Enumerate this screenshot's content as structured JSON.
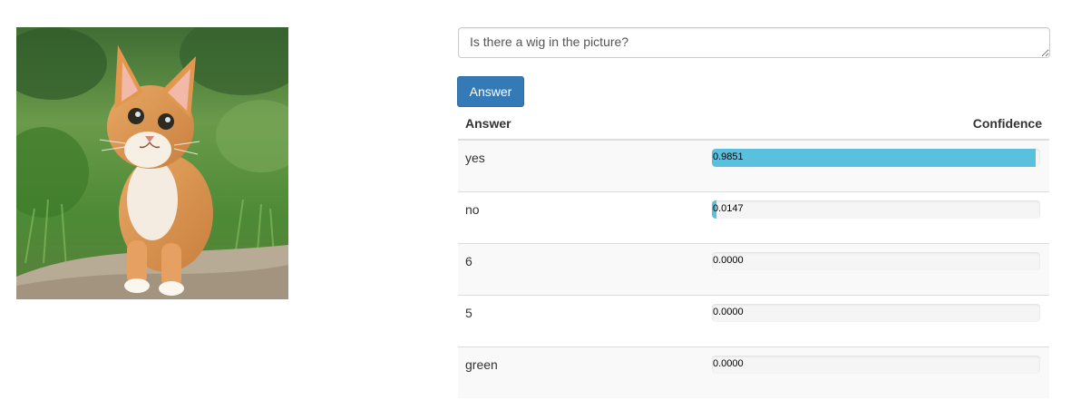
{
  "image": {
    "description_icon": "kitten-photo"
  },
  "question": {
    "value": "Is there a wig in the picture?"
  },
  "answer_button": {
    "label": "Answer"
  },
  "results": {
    "headers": {
      "answer": "Answer",
      "confidence": "Confidence"
    },
    "rows": [
      {
        "answer": "yes",
        "confidence_text": "0.9851",
        "confidence": 0.9851
      },
      {
        "answer": "no",
        "confidence_text": "0.0147",
        "confidence": 0.0147
      },
      {
        "answer": "6",
        "confidence_text": "0.0000",
        "confidence": 0.0
      },
      {
        "answer": "5",
        "confidence_text": "0.0000",
        "confidence": 0.0
      },
      {
        "answer": "green",
        "confidence_text": "0.0000",
        "confidence": 0.0
      }
    ]
  },
  "colors": {
    "bar_fill": "#5bc0de",
    "button": "#337ab7",
    "track": "#f5f5f5"
  }
}
